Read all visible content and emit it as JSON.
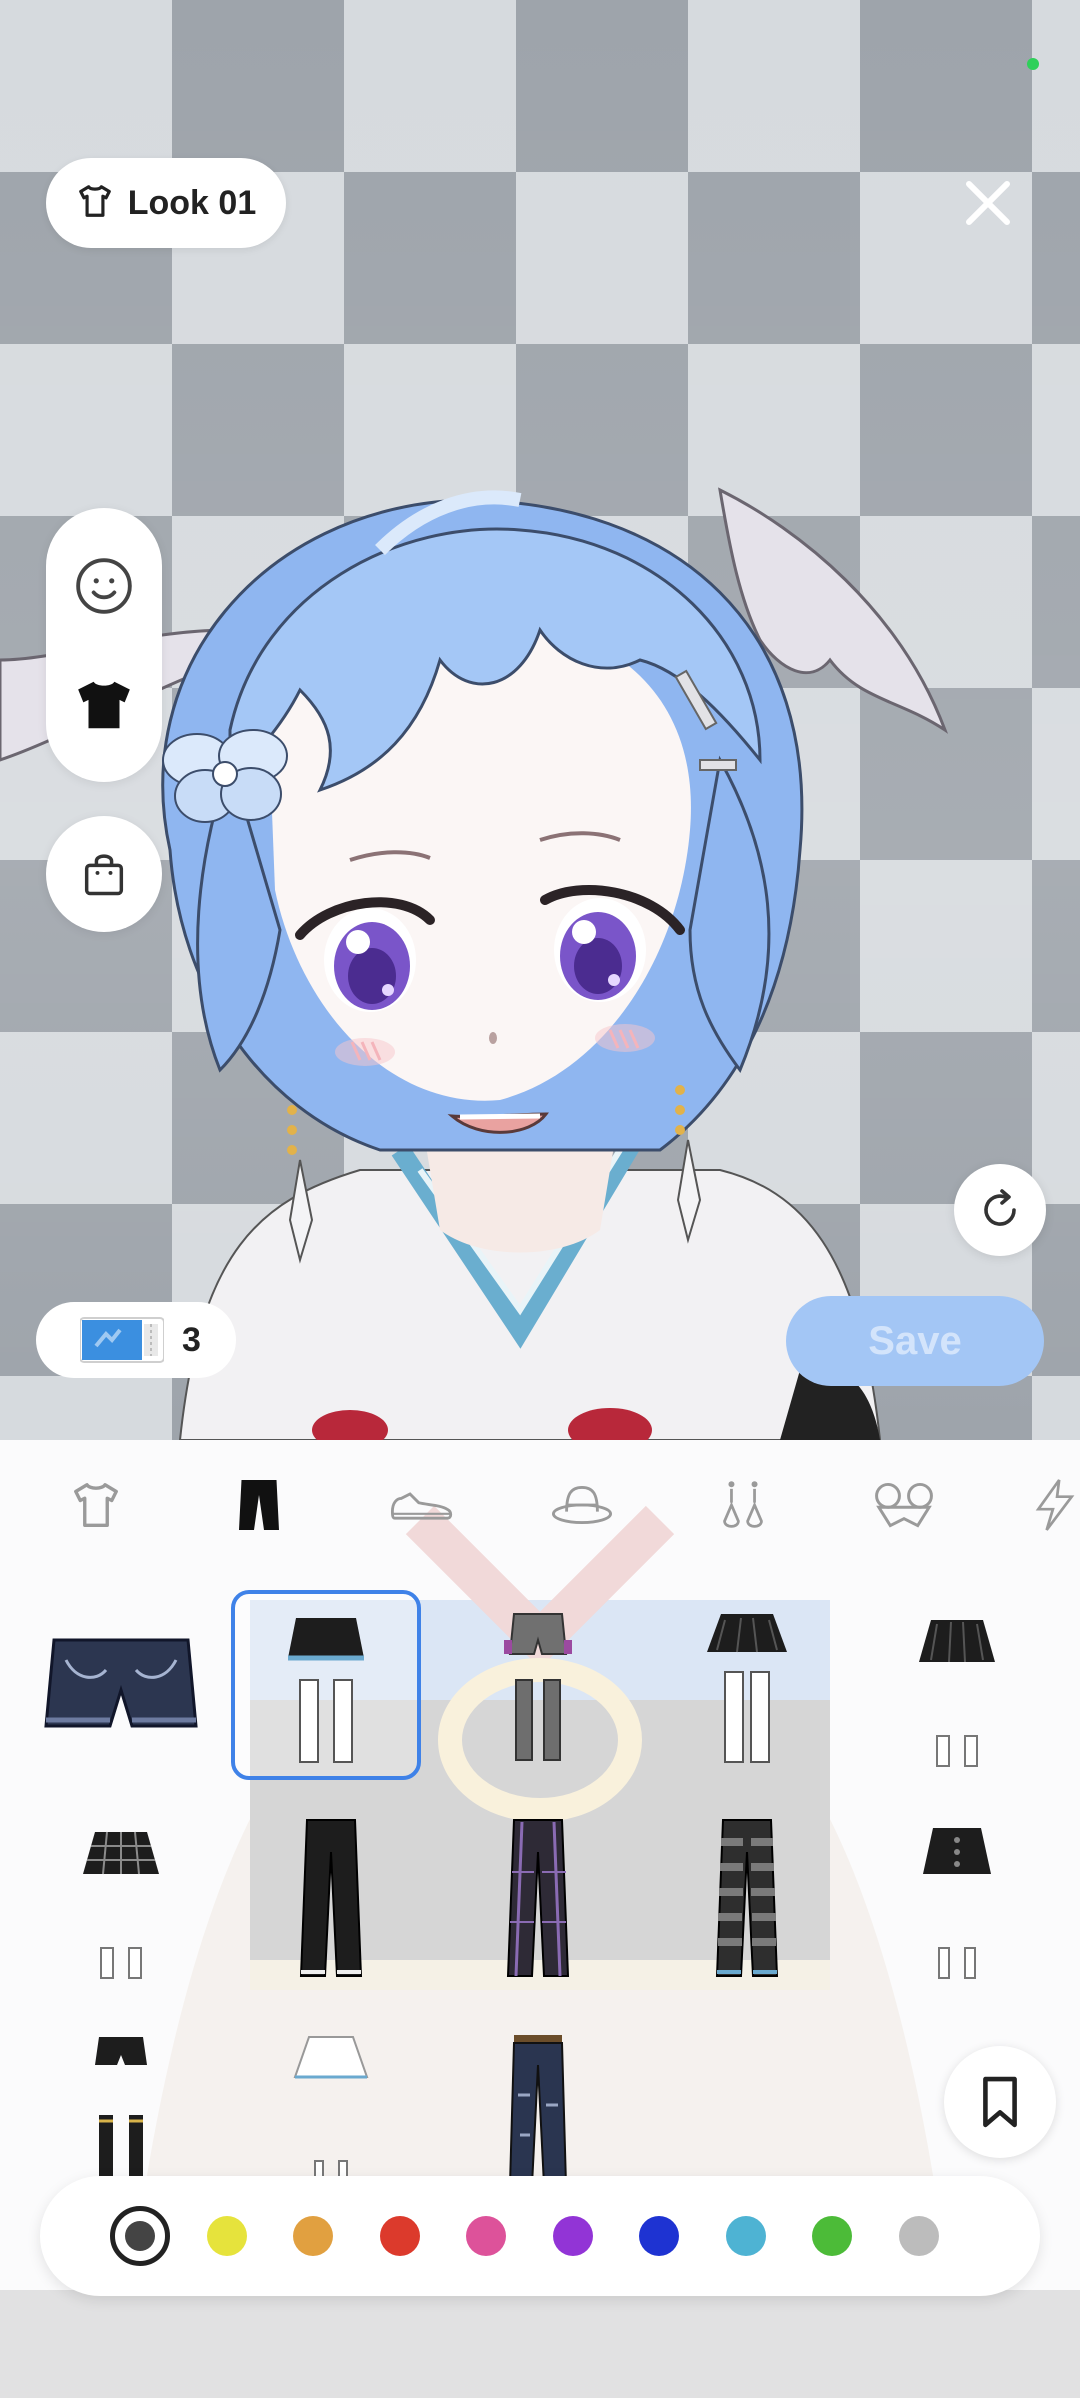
{
  "header": {
    "look_label": "Look 01"
  },
  "icons": {
    "look": "tshirt-outline-icon",
    "close": "close-icon",
    "face": "smiley-face-icon",
    "clothes": "tshirt-filled-icon",
    "shop": "shopping-bag-icon",
    "rotate": "rotate-icon",
    "ticket": "ticket-icon",
    "bookmark": "bookmark-icon"
  },
  "ticket": {
    "count": "3"
  },
  "actions": {
    "save_label": "Save"
  },
  "categories": [
    {
      "name": "tops",
      "icon": "tshirt-outline-icon",
      "selected": false
    },
    {
      "name": "bottoms",
      "icon": "pants-icon",
      "selected": true
    },
    {
      "name": "shoes",
      "icon": "sneaker-icon",
      "selected": false
    },
    {
      "name": "hats",
      "icon": "hat-icon",
      "selected": false
    },
    {
      "name": "earrings",
      "icon": "earrings-icon",
      "selected": false
    },
    {
      "name": "glasses",
      "icon": "glasses-icon",
      "selected": false
    },
    {
      "name": "special",
      "icon": "lightning-icon",
      "selected": false
    }
  ],
  "items": [
    {
      "name": "denim-shorts",
      "selected": false
    },
    {
      "name": "skirt-white-stockings-blue-trim",
      "selected": true
    },
    {
      "name": "shorts-grey-stockings",
      "selected": false
    },
    {
      "name": "black-skirt-white-stockings",
      "selected": false
    },
    {
      "name": "black-skirt-white-socks",
      "selected": false
    },
    {
      "name": "plaid-skirt-white-socks",
      "selected": false
    },
    {
      "name": "black-pants",
      "selected": false
    },
    {
      "name": "purple-plaid-pants",
      "selected": false
    },
    {
      "name": "striped-pants",
      "selected": false
    },
    {
      "name": "button-skirt-socks",
      "selected": false
    },
    {
      "name": "shorts-knee-socks",
      "selected": false
    },
    {
      "name": "white-skirt-socks",
      "selected": false
    },
    {
      "name": "ripped-jeans",
      "selected": false
    }
  ],
  "colors": {
    "brand": "#3f82e8",
    "save_disabled": "#a3c6f5",
    "swatches": [
      "#e6e33c",
      "#e1a040",
      "#dc3a2c",
      "#dd529a",
      "#9234d6",
      "#1e33d2",
      "#4eb3d3",
      "#4cbb38",
      "#bcbcbc"
    ],
    "selected_swatch": "default"
  }
}
